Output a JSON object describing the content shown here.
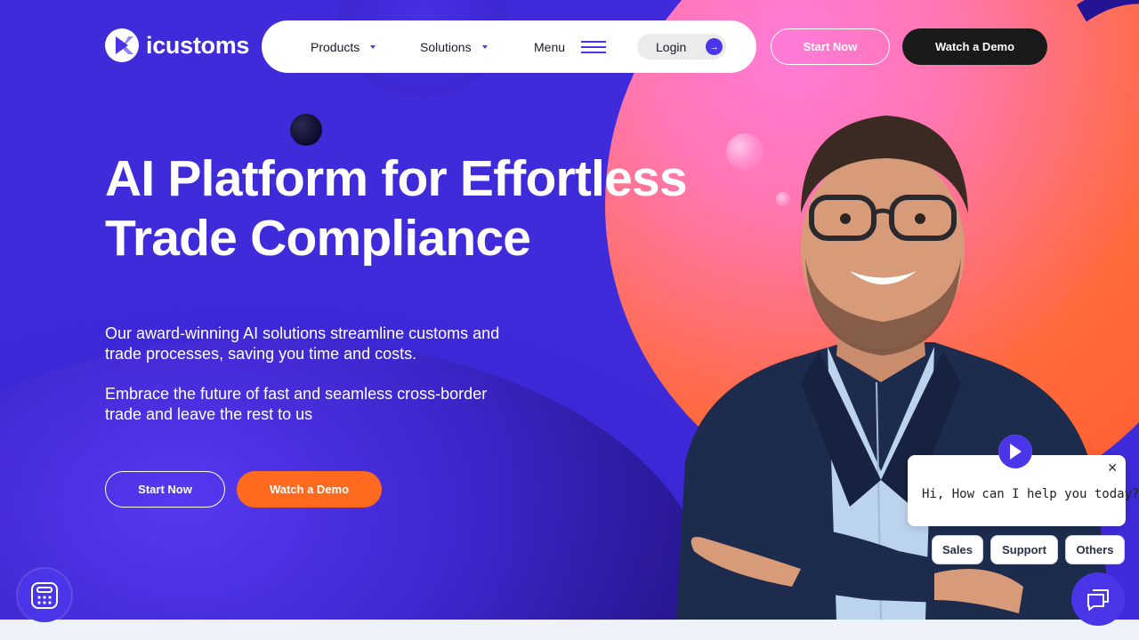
{
  "brand": {
    "name": "icustoms"
  },
  "nav": {
    "items": [
      {
        "label": "Products"
      },
      {
        "label": "Solutions"
      },
      {
        "label": "Menu"
      }
    ],
    "login_label": "Login",
    "start_label": "Start Now",
    "demo_label": "Watch a Demo"
  },
  "hero": {
    "headline_line1": "AI Platform for Effortless",
    "headline_line2": "Trade Compliance",
    "description_1": "Our award-winning AI solutions streamline customs and trade processes, saving you time and costs.",
    "description_2": "Embrace the future of fast and seamless cross-border trade and leave the rest to us",
    "cta_start": "Start Now",
    "cta_demo": "Watch a Demo"
  },
  "chat": {
    "message": "Hi, How can I help you today?",
    "close_symbol": "✕",
    "options": [
      "Sales",
      "Support",
      "Others"
    ]
  },
  "colors": {
    "background": "#3f2bd9",
    "accent": "#4a36e8",
    "orange": "#ff6a1f",
    "dark_button": "#1a1a1a"
  },
  "icons": {
    "logo": "logo-mark-icon",
    "login_arrow": "arrow-right-icon",
    "calculator": "calculator-icon",
    "chat": "chat-bubbles-icon"
  }
}
